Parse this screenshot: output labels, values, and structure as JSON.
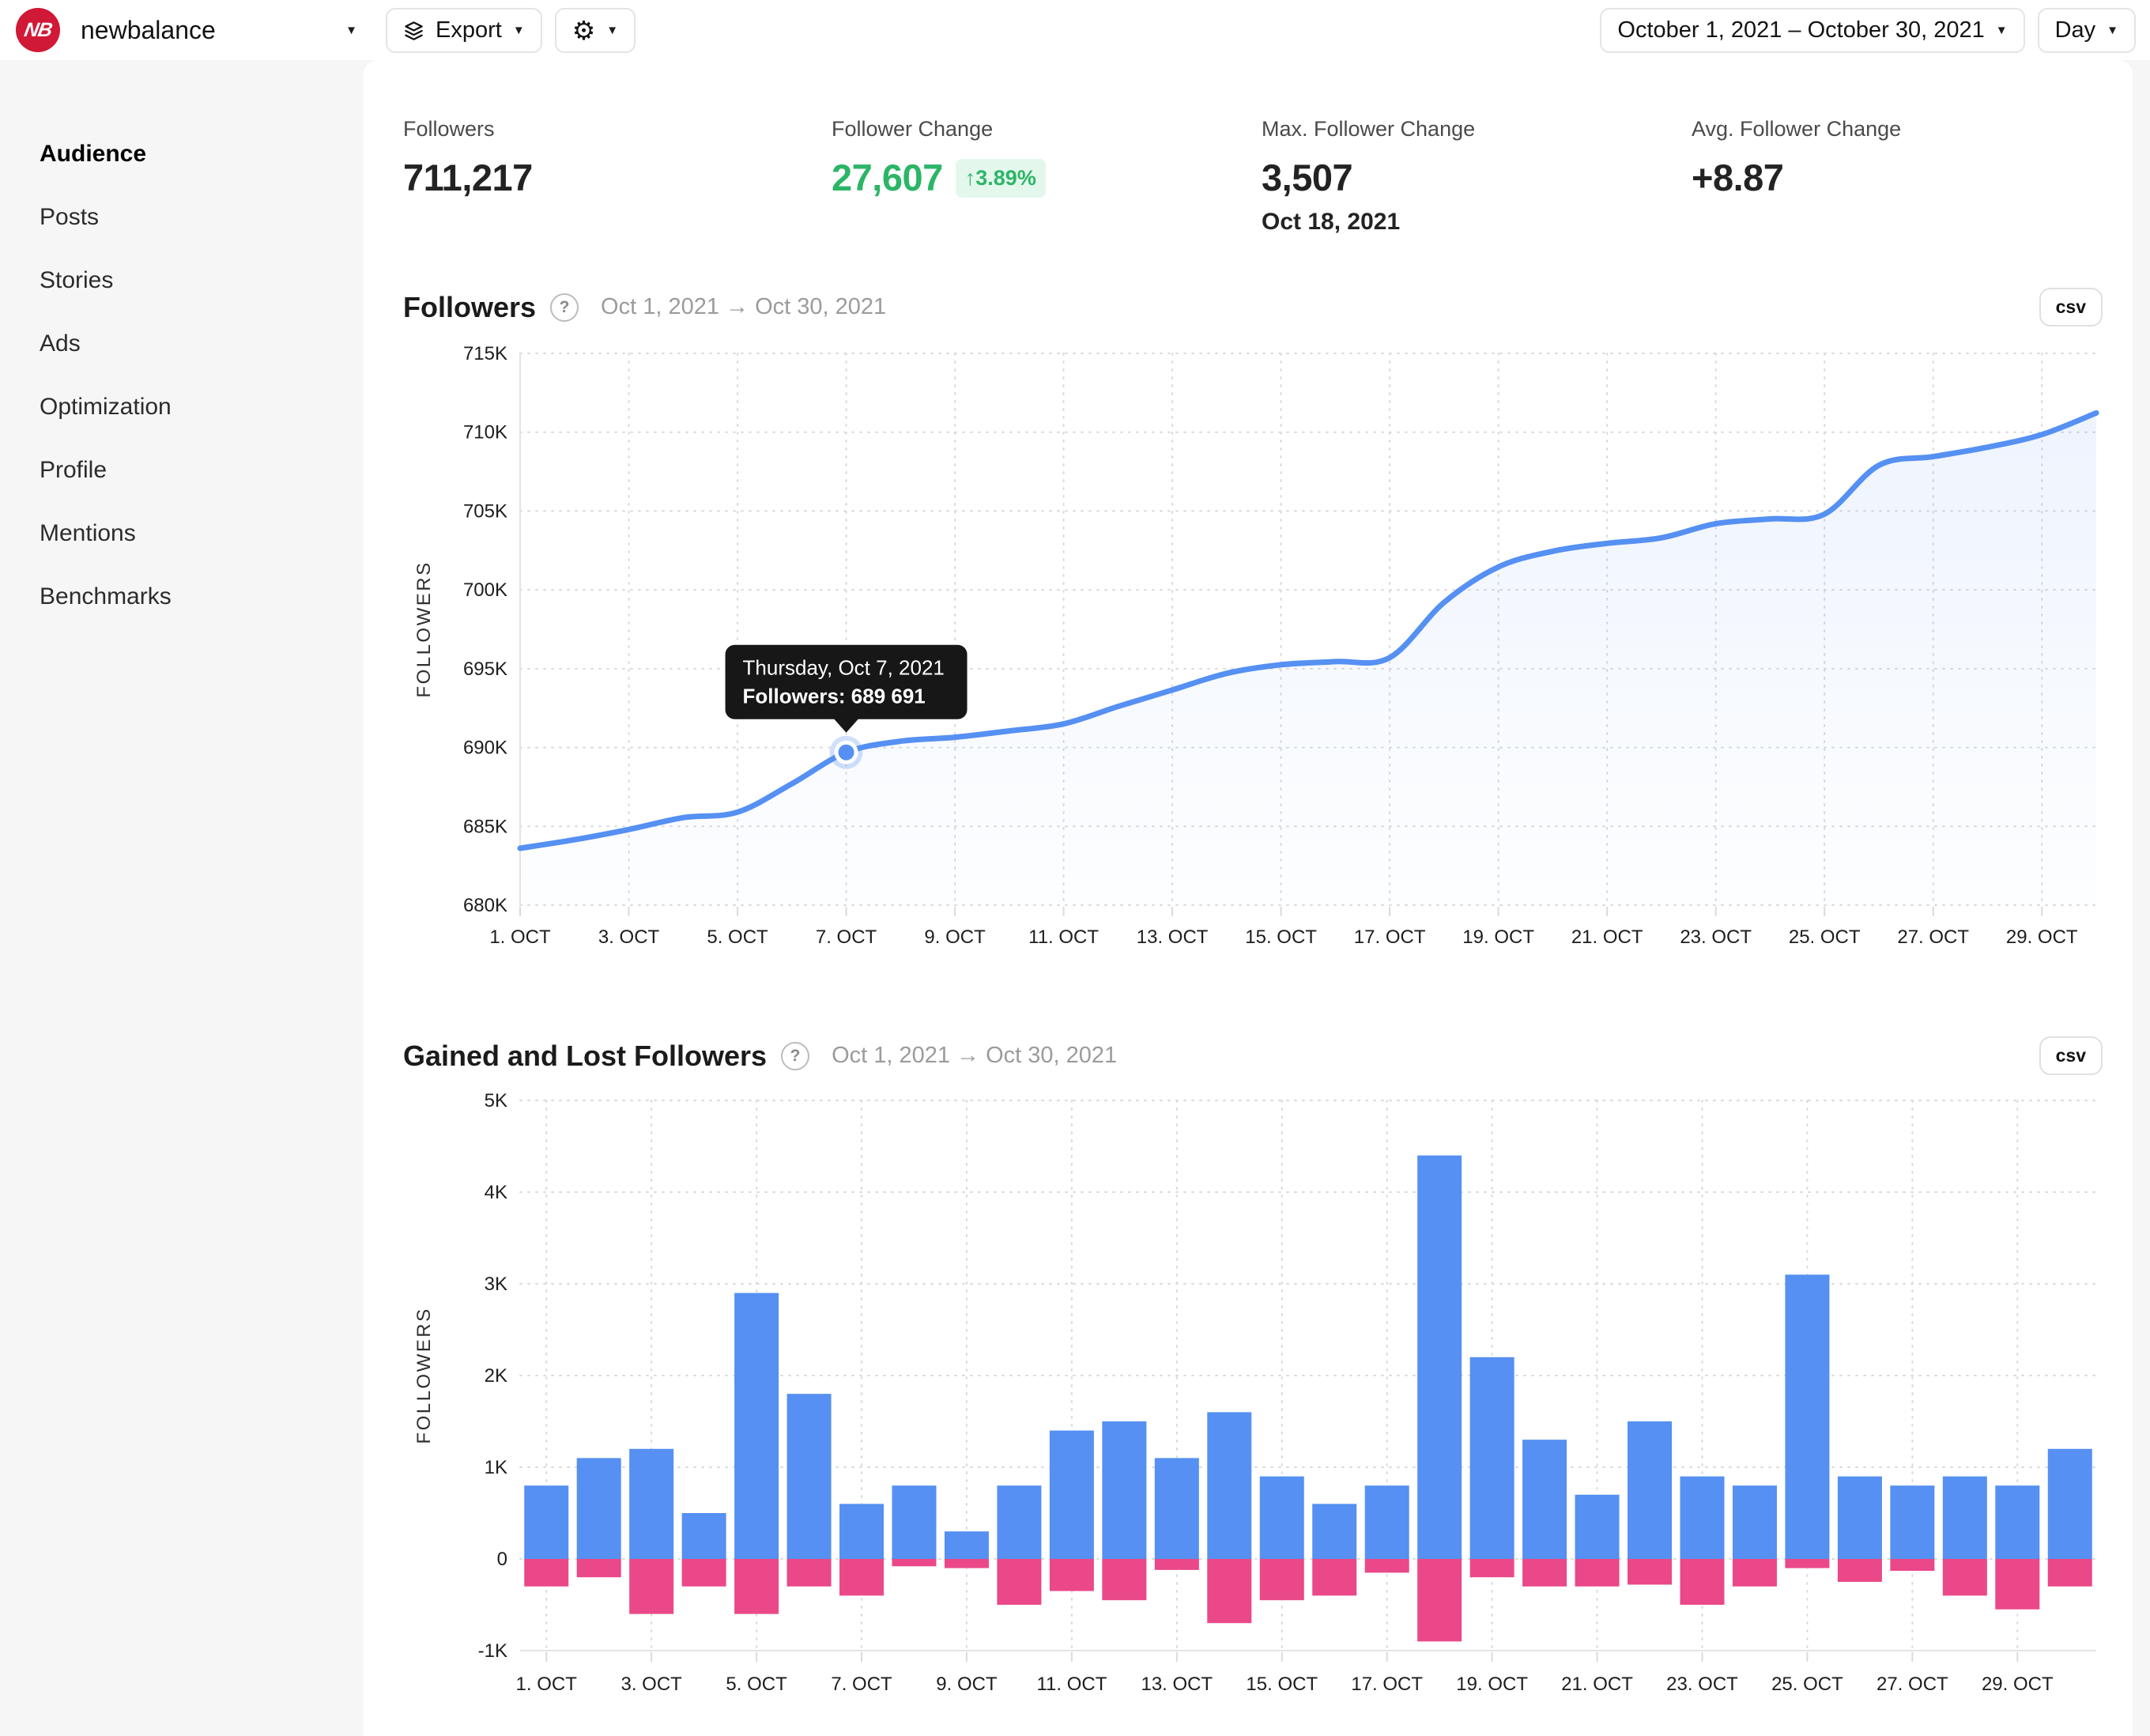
{
  "header": {
    "account_name": "newbalance",
    "export_label": "Export",
    "date_range_label": "October 1, 2021 – October 30, 2021",
    "granularity_label": "Day",
    "logo_text": "NB"
  },
  "sidebar": {
    "items": [
      {
        "label": "Audience",
        "active": true
      },
      {
        "label": "Posts",
        "active": false
      },
      {
        "label": "Stories",
        "active": false
      },
      {
        "label": "Ads",
        "active": false
      },
      {
        "label": "Optimization",
        "active": false
      },
      {
        "label": "Profile",
        "active": false
      },
      {
        "label": "Mentions",
        "active": false
      },
      {
        "label": "Benchmarks",
        "active": false
      }
    ]
  },
  "stats": [
    {
      "label": "Followers",
      "value": "711,217"
    },
    {
      "label": "Follower Change",
      "value": "27,607",
      "badge_arrow": "↑",
      "badge": "3.89%"
    },
    {
      "label": "Max. Follower Change",
      "value": "3,507",
      "sub": "Oct 18, 2021"
    },
    {
      "label": "Avg. Follower Change",
      "value": "+8.87"
    }
  ],
  "sections": {
    "followers": {
      "title": "Followers",
      "date_range": "Oct 1, 2021 → Oct 30, 2021",
      "csv_label": "csv"
    },
    "gained_lost": {
      "title": "Gained and Lost Followers",
      "date_range": "Oct 1, 2021 → Oct 30, 2021",
      "csv_label": "csv"
    }
  },
  "chart_data": [
    {
      "type": "line",
      "title": "Followers",
      "ylabel": "FOLLOWERS",
      "ylim": [
        680000,
        715000
      ],
      "ytick_step": 5000,
      "ytick_labels": [
        "680K",
        "685K",
        "690K",
        "695K",
        "700K",
        "705K",
        "710K",
        "715K"
      ],
      "xtick_labels": [
        "1. OCT",
        "3. OCT",
        "5. OCT",
        "7. OCT",
        "9. OCT",
        "11. OCT",
        "13. OCT",
        "15. OCT",
        "17. OCT",
        "19. OCT",
        "21. OCT",
        "23. OCT",
        "25. OCT",
        "27. OCT",
        "29. OCT"
      ],
      "x": [
        "Oct 1",
        "Oct 2",
        "Oct 3",
        "Oct 4",
        "Oct 5",
        "Oct 6",
        "Oct 7",
        "Oct 8",
        "Oct 9",
        "Oct 10",
        "Oct 11",
        "Oct 12",
        "Oct 13",
        "Oct 14",
        "Oct 15",
        "Oct 16",
        "Oct 17",
        "Oct 18",
        "Oct 19",
        "Oct 20",
        "Oct 21",
        "Oct 22",
        "Oct 23",
        "Oct 24",
        "Oct 25",
        "Oct 26",
        "Oct 27",
        "Oct 28",
        "Oct 29",
        "Oct 30"
      ],
      "values": [
        683610,
        684150,
        684800,
        685550,
        685900,
        687700,
        689691,
        690400,
        690650,
        691050,
        691500,
        692600,
        693650,
        694700,
        695250,
        695450,
        695700,
        699200,
        701450,
        702450,
        702950,
        703300,
        704200,
        704500,
        704800,
        707900,
        708450,
        709050,
        709850,
        711217
      ],
      "line_color": "#5590f2",
      "grid": true,
      "tooltip": {
        "day_index": 6,
        "value": 689691,
        "title": "Thursday, Oct 7, 2021",
        "label": "Followers: 689 691"
      }
    },
    {
      "type": "bar",
      "title": "Gained and Lost Followers",
      "ylabel": "FOLLOWERS",
      "ylim": [
        -1000,
        5000
      ],
      "ytick_step": 1000,
      "ytick_labels": [
        "-1K",
        "0",
        "1K",
        "2K",
        "3K",
        "4K",
        "5K"
      ],
      "xtick_labels": [
        "1. OCT",
        "3. OCT",
        "5. OCT",
        "7. OCT",
        "9. OCT",
        "11. OCT",
        "13. OCT",
        "15. OCT",
        "17. OCT",
        "19. OCT",
        "21. OCT",
        "23. OCT",
        "25. OCT",
        "27. OCT",
        "29. OCT"
      ],
      "categories": [
        "Oct 1",
        "Oct 2",
        "Oct 3",
        "Oct 4",
        "Oct 5",
        "Oct 6",
        "Oct 7",
        "Oct 8",
        "Oct 9",
        "Oct 10",
        "Oct 11",
        "Oct 12",
        "Oct 13",
        "Oct 14",
        "Oct 15",
        "Oct 16",
        "Oct 17",
        "Oct 18",
        "Oct 19",
        "Oct 20",
        "Oct 21",
        "Oct 22",
        "Oct 23",
        "Oct 24",
        "Oct 25",
        "Oct 26",
        "Oct 27",
        "Oct 28",
        "Oct 29",
        "Oct 30"
      ],
      "series": [
        {
          "name": "Gained",
          "color": "#5590f2",
          "values": [
            800,
            1100,
            1200,
            500,
            2900,
            1800,
            600,
            800,
            300,
            800,
            1400,
            1500,
            1100,
            1600,
            900,
            600,
            800,
            4400,
            2200,
            1300,
            700,
            1500,
            900,
            800,
            3100,
            900,
            800,
            900,
            800,
            1200
          ]
        },
        {
          "name": "Lost",
          "color": "#ea4889",
          "values": [
            -300,
            -200,
            -600,
            -300,
            -600,
            -300,
            -400,
            -80,
            -100,
            -500,
            -350,
            -450,
            -120,
            -700,
            -450,
            -400,
            -150,
            -900,
            -200,
            -300,
            -300,
            -280,
            -500,
            -300,
            -100,
            -250,
            -130,
            -400,
            -550,
            -300
          ]
        }
      ],
      "grid": true
    }
  ]
}
